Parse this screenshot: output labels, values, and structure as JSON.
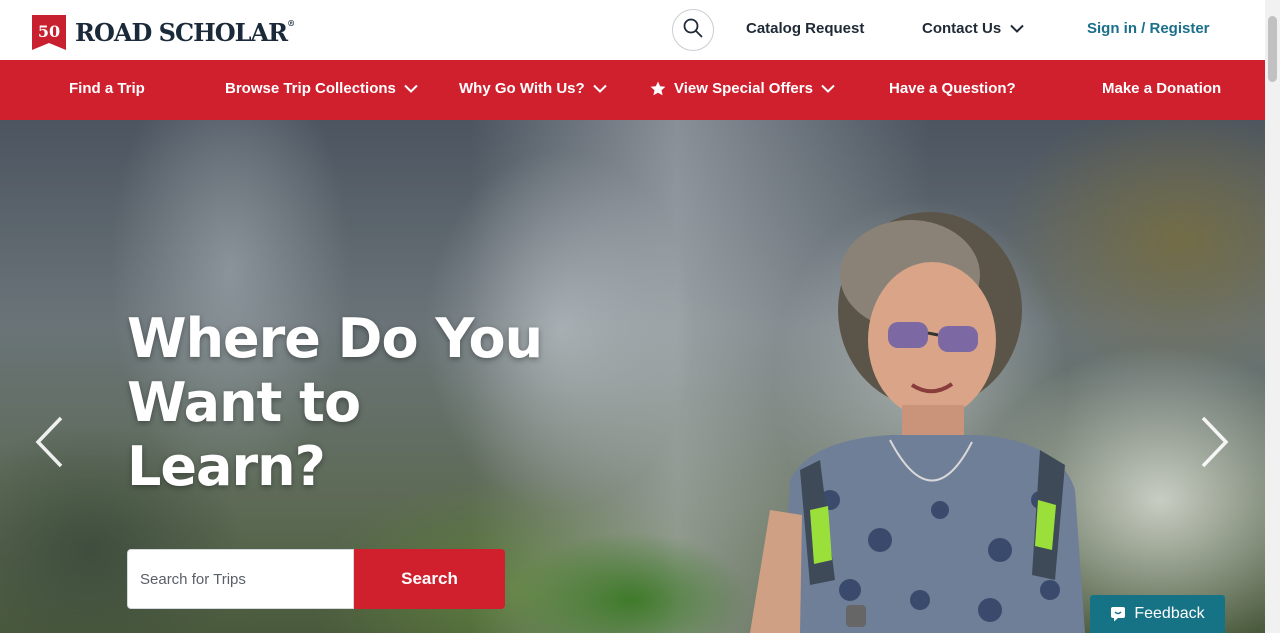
{
  "header": {
    "logo_badge": "50",
    "logo_text": "ROAD SCHOLAR",
    "logo_reg": "®",
    "catalog": "Catalog Request",
    "contact": "Contact Us",
    "signin": "Sign in / Register"
  },
  "nav": {
    "items": [
      {
        "label": "Find a Trip"
      },
      {
        "label": "Browse Trip Collections"
      },
      {
        "label": "Why Go With Us?"
      },
      {
        "label": "View Special Offers"
      },
      {
        "label": "Have a Question?"
      },
      {
        "label": "Make a Donation"
      }
    ]
  },
  "hero": {
    "headline": [
      "Where Do You",
      "Want to",
      "Learn?"
    ],
    "search_placeholder": "Search for Trips",
    "search_button": "Search"
  },
  "feedback": "Feedback",
  "colors": {
    "brand_red": "#d0202e",
    "link_teal": "#1a6f8a",
    "feedback_bg": "#167386"
  }
}
